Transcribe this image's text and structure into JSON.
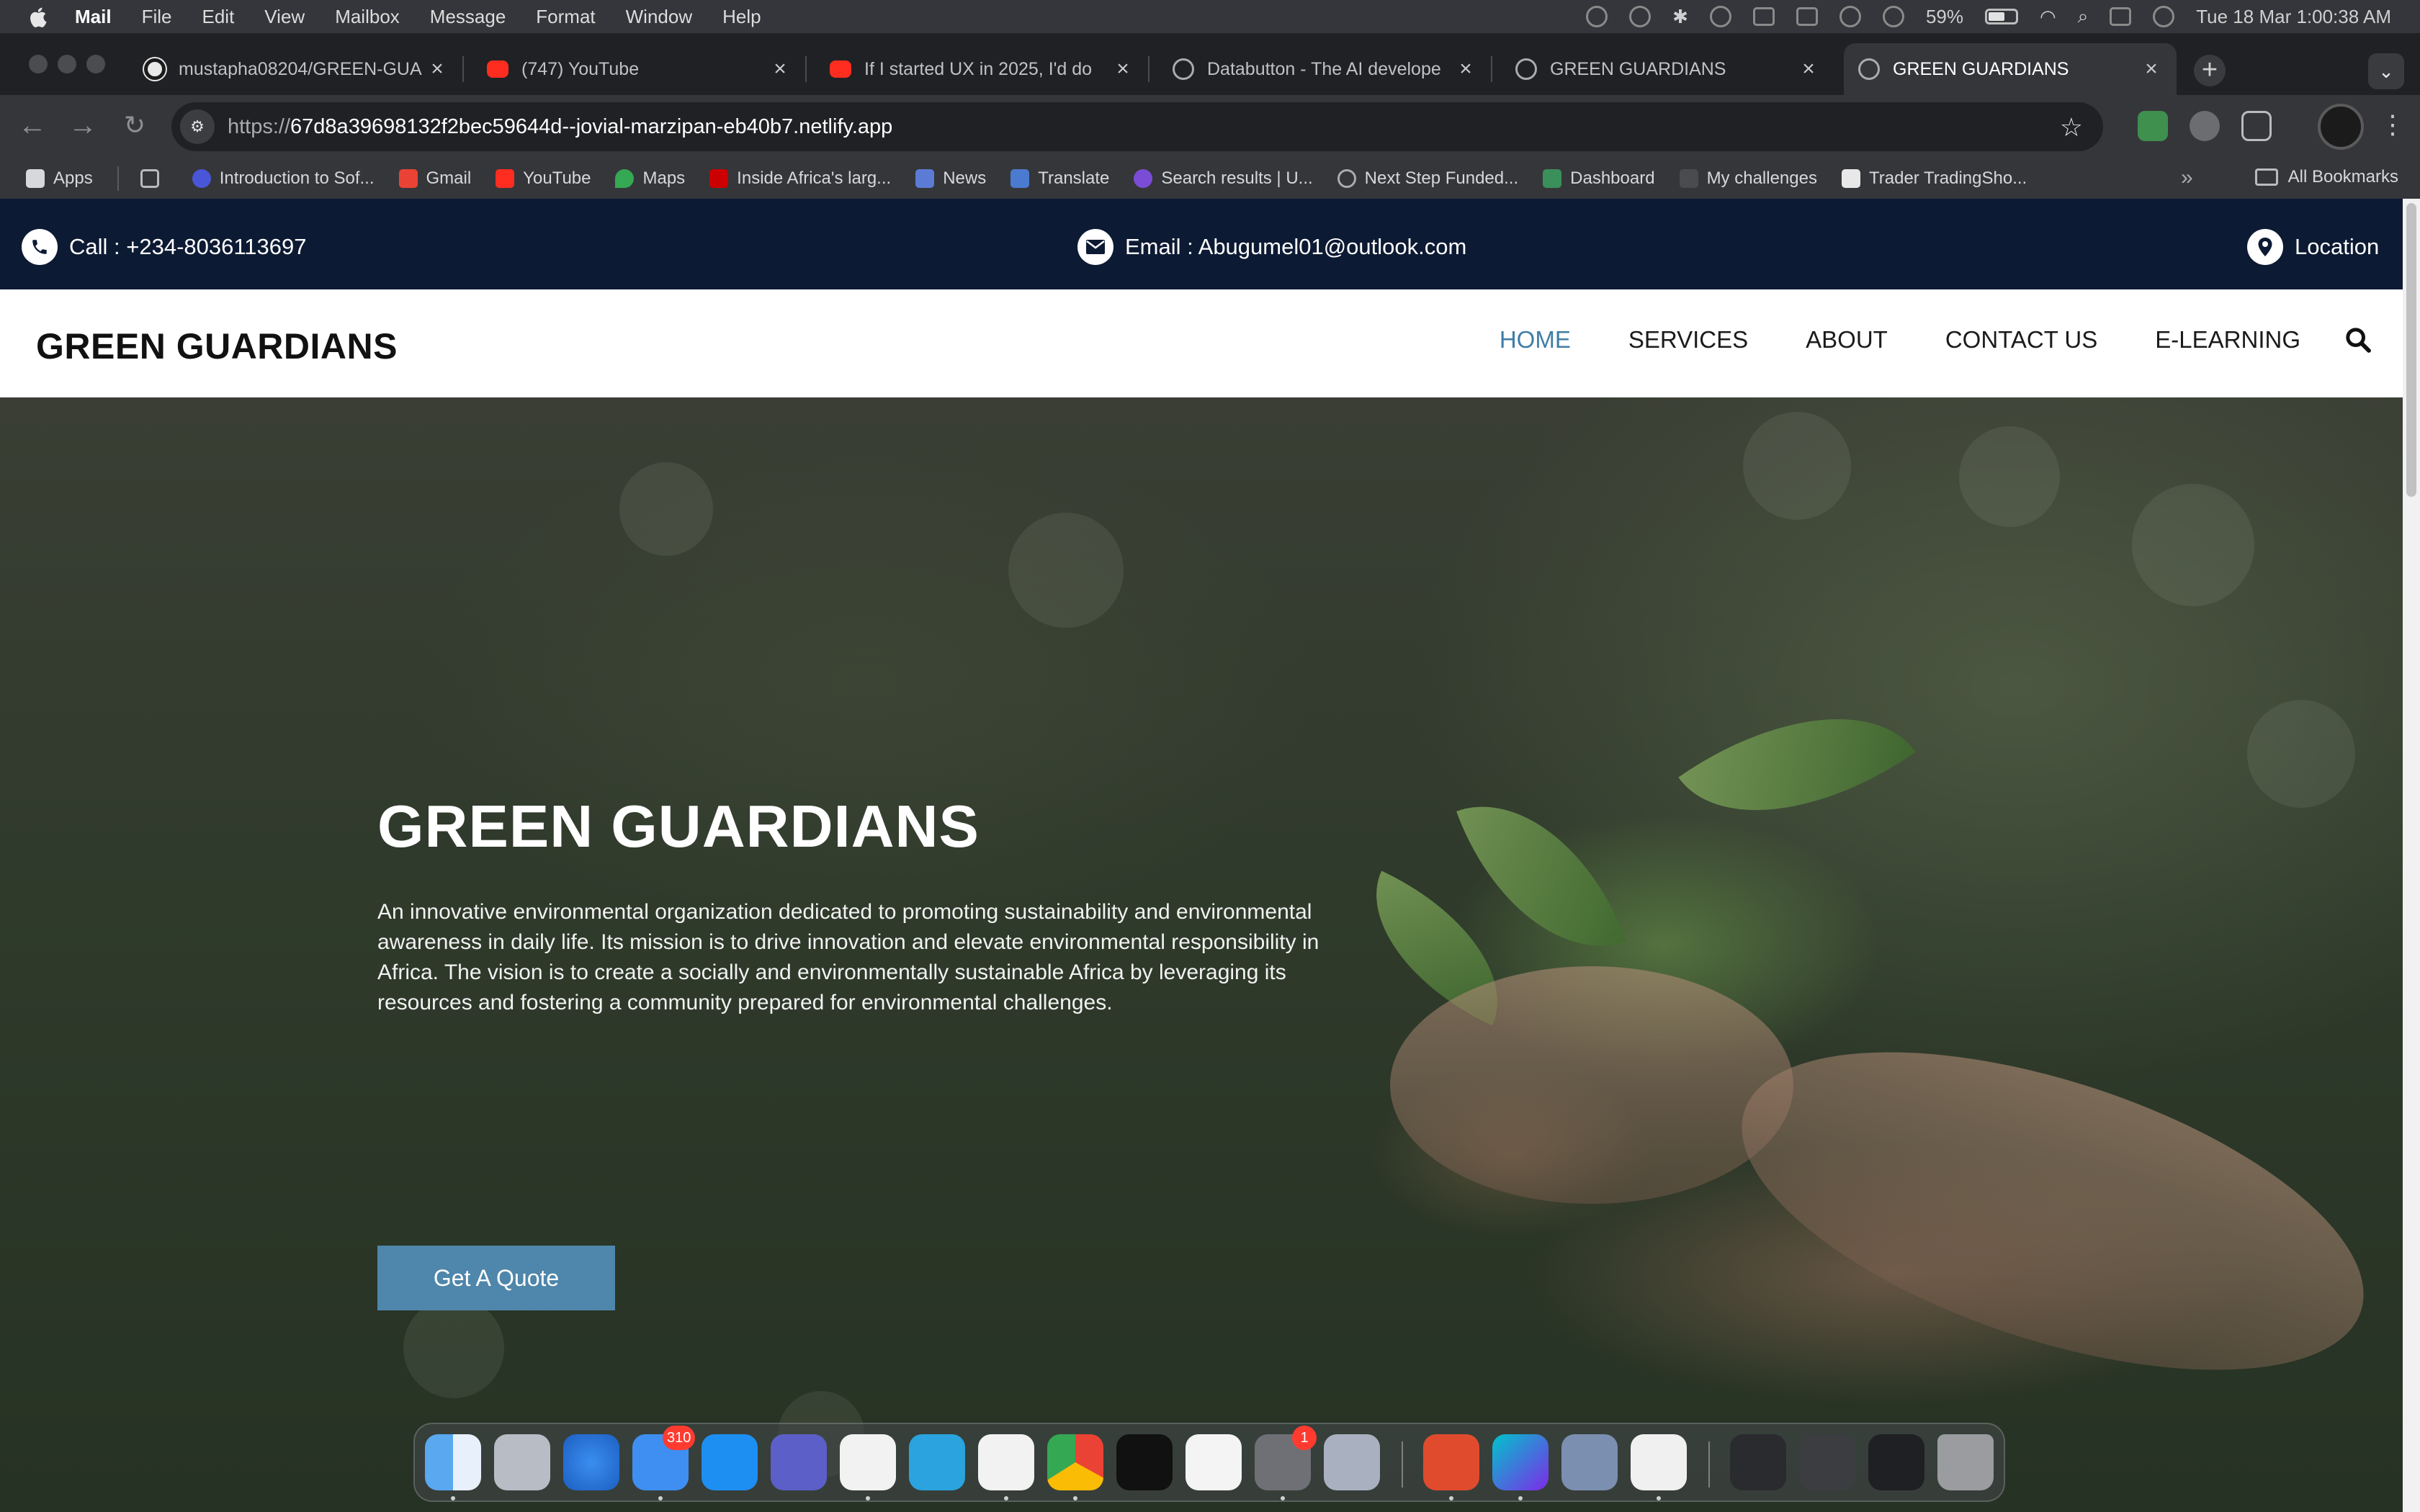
{
  "menubar": {
    "app": "Mail",
    "items": [
      "File",
      "Edit",
      "View",
      "Mailbox",
      "Message",
      "Format",
      "Window",
      "Help"
    ],
    "battery": "59%",
    "datetime": "Tue 18 Mar  1:00:38 AM"
  },
  "browser": {
    "tabs": [
      {
        "title": "mustapha08204/GREEN-GUA",
        "icon": "github-icon"
      },
      {
        "title": "(747) YouTube",
        "icon": "youtube-icon"
      },
      {
        "title": "If I started UX in 2025, I'd do",
        "icon": "youtube-icon"
      },
      {
        "title": "Databutton - The AI develope",
        "icon": "globe-icon"
      },
      {
        "title": "GREEN GUARDIANS",
        "icon": "globe-icon"
      },
      {
        "title": "GREEN GUARDIANS",
        "icon": "globe-icon"
      }
    ],
    "url_scheme": "https://",
    "url_host": "67d8a39698132f2bec59644d--jovial-marzipan-eb40b7.netlify.app",
    "bookmarks": [
      "Apps",
      "Introduction to Sof...",
      "Gmail",
      "YouTube",
      "Maps",
      "Inside Africa's larg...",
      "News",
      "Translate",
      "Search results | U...",
      "Next Step Funded...",
      "Dashboard",
      "My challenges",
      "Trader TradingSho..."
    ],
    "all_bookmarks": "All Bookmarks"
  },
  "site": {
    "topbar": {
      "call": "Call : +234-8036113697",
      "email": "Email : Abugumel01@outlook.com",
      "location": "Location"
    },
    "brand": "GREEN GUARDIANS",
    "nav": [
      "HOME",
      "SERVICES",
      "ABOUT",
      "CONTACT US",
      "E-LEARNING"
    ],
    "hero": {
      "title": "GREEN GUARDIANS",
      "description": "An innovative environmental organization dedicated to promoting sustainability and environmental awareness in daily life. Its mission is to drive innovation and elevate environmental responsibility in Africa. The vision is to create a socially and environmentally sustainable Africa by leveraging its resources and fostering a community prepared for environmental challenges.",
      "button": "Get A Quote"
    }
  },
  "dock": {
    "mail_badge": "310",
    "settings_badge": "1"
  },
  "colors": {
    "topbar_bg": "#0d1a33",
    "nav_active": "#3f7ea6",
    "button_bg": "#4f86ab"
  }
}
